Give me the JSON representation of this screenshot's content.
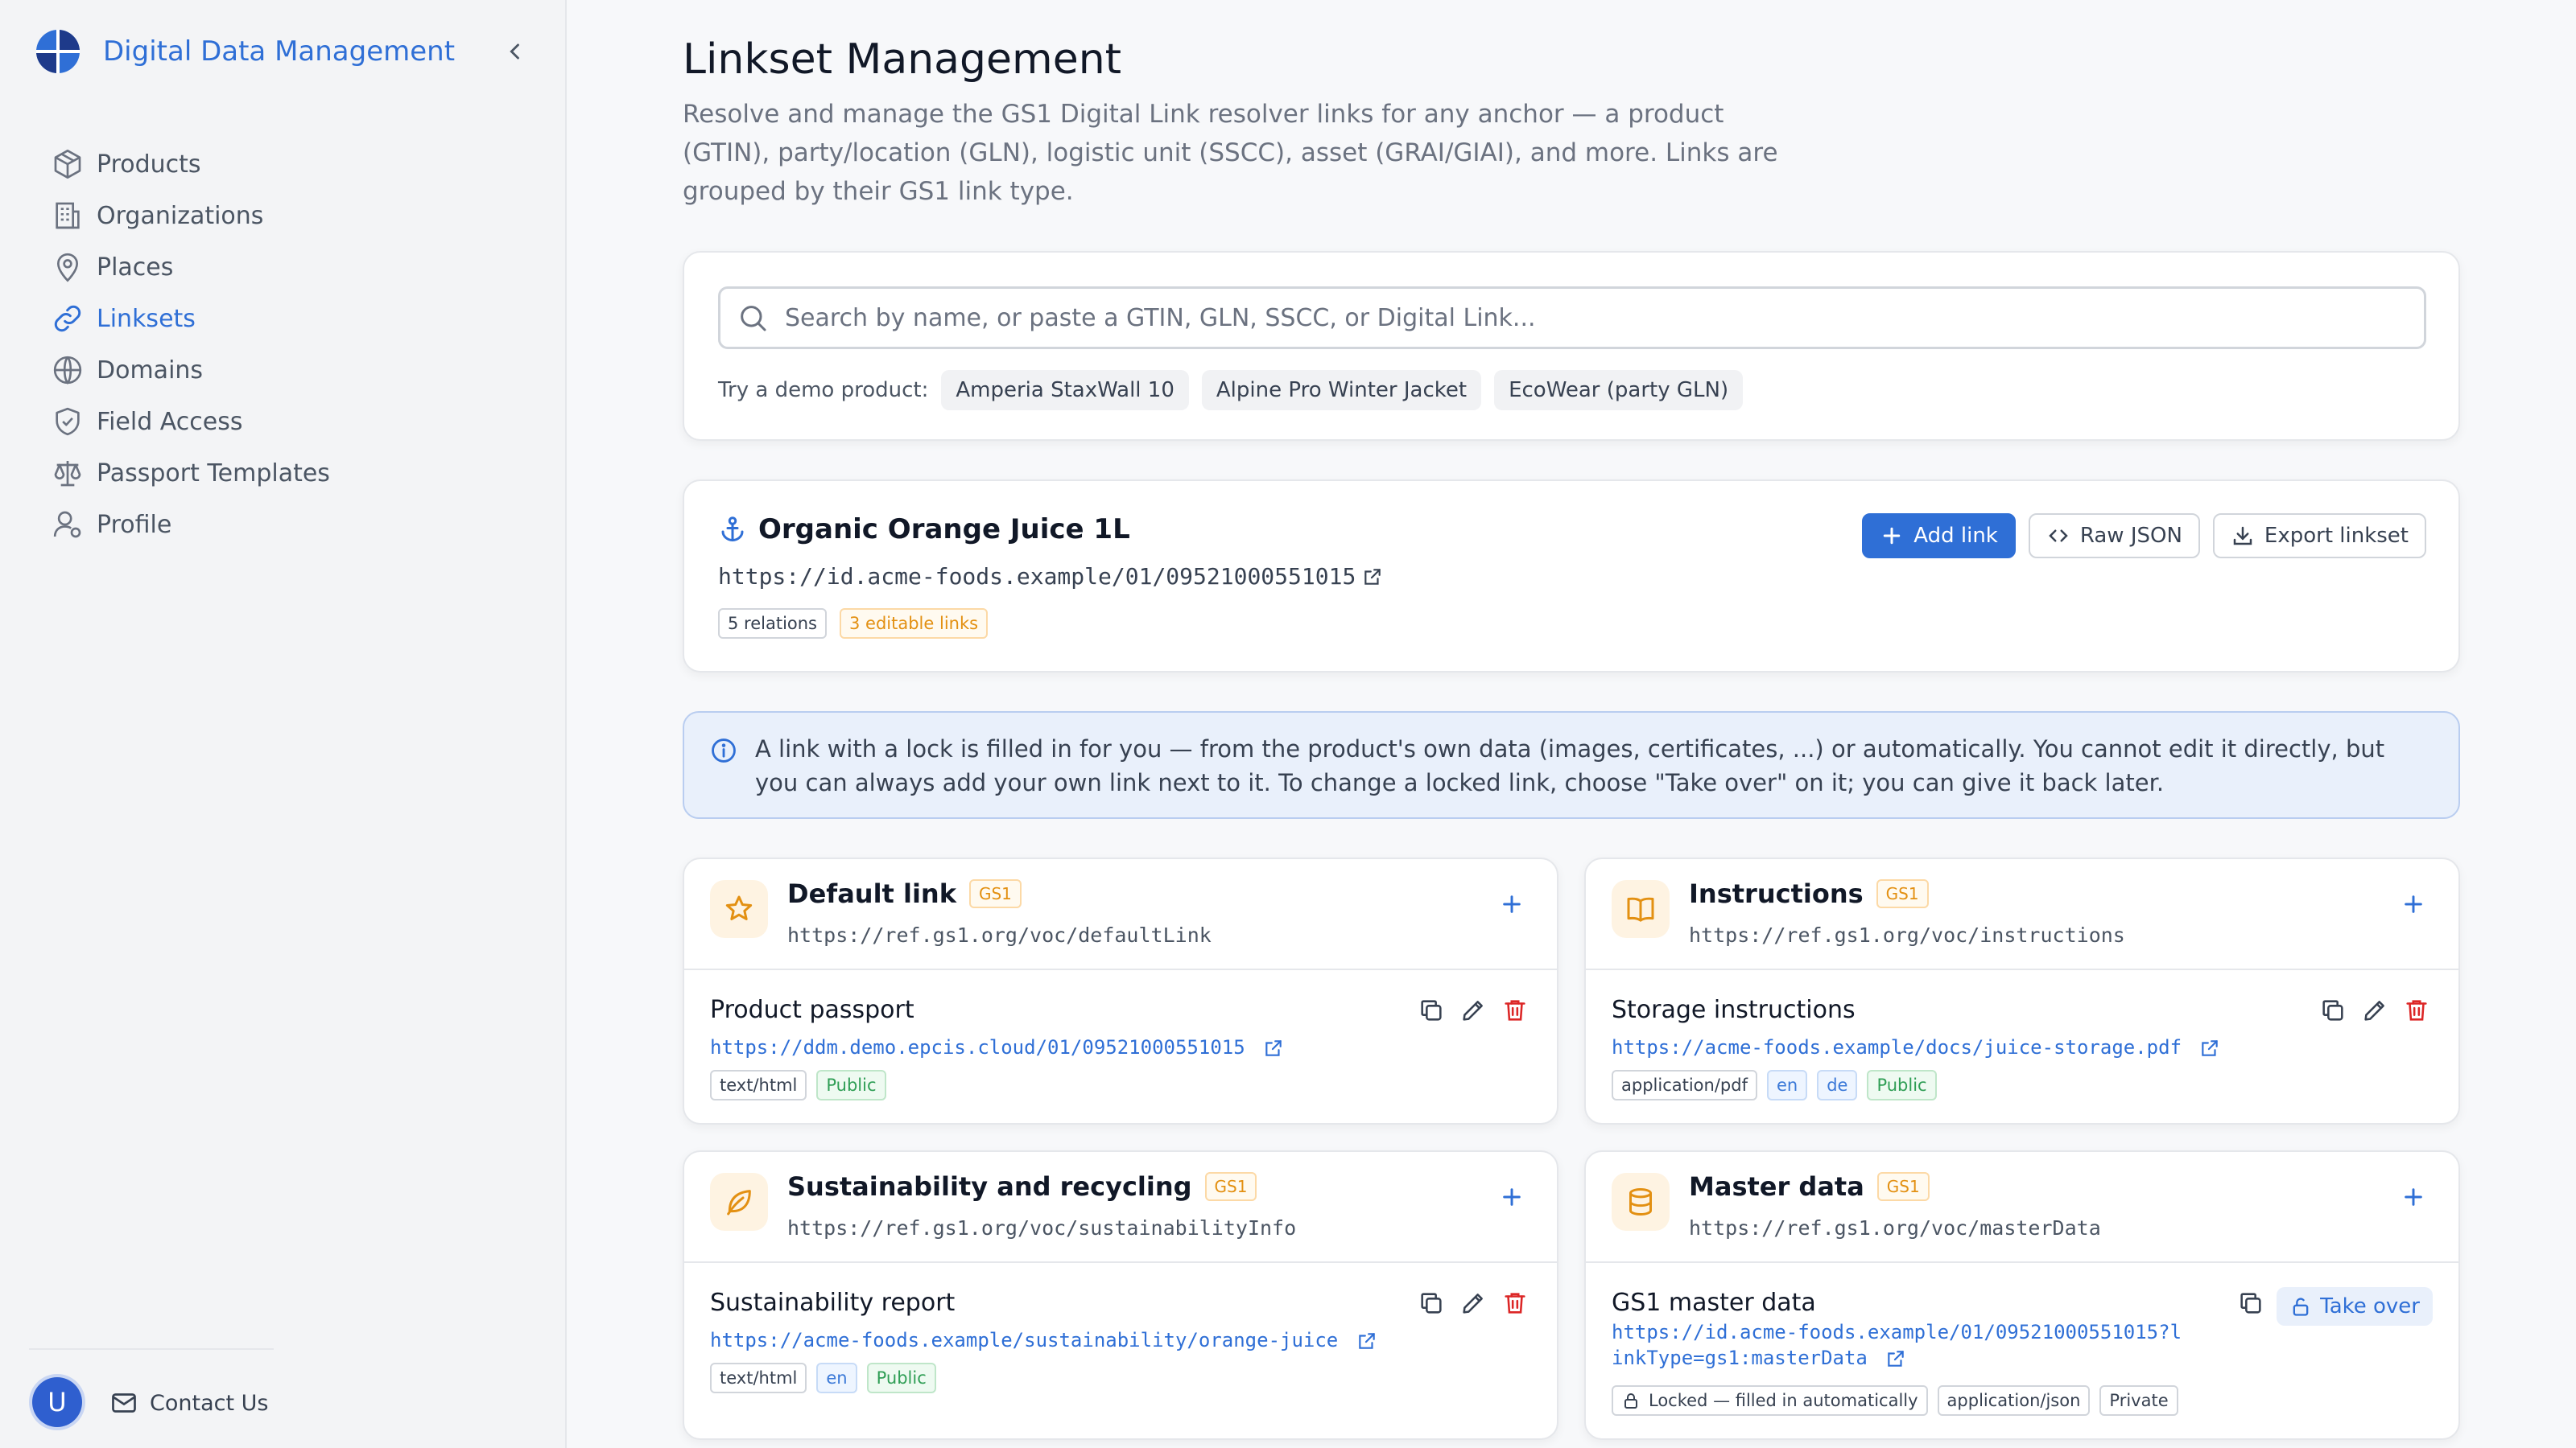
{
  "app": {
    "title": "Digital Data Management"
  },
  "sidebar": {
    "items": [
      {
        "label": "Products",
        "icon": "box-icon"
      },
      {
        "label": "Organizations",
        "icon": "building-icon"
      },
      {
        "label": "Places",
        "icon": "map-pin-icon"
      },
      {
        "label": "Linksets",
        "icon": "link-icon",
        "active": true
      },
      {
        "label": "Domains",
        "icon": "globe-icon"
      },
      {
        "label": "Field Access",
        "icon": "shield-icon"
      },
      {
        "label": "Passport Templates",
        "icon": "scale-icon"
      },
      {
        "label": "Profile",
        "icon": "user-icon"
      }
    ],
    "avatar_initial": "U",
    "contact_label": "Contact Us"
  },
  "page": {
    "title": "Linkset Management",
    "description": "Resolve and manage the GS1 Digital Link resolver links for any anchor — a product (GTIN), party/location (GLN), logistic unit (SSCC), asset (GRAI/GIAI), and more. Links are grouped by their GS1 link type."
  },
  "search": {
    "placeholder": "Search by name, or paste a GTIN, GLN, SSCC, or Digital Link...",
    "value": "",
    "demo_label": "Try a demo product:",
    "demo_chips": [
      "Amperia StaxWall 10",
      "Alpine Pro Winter Jacket",
      "EcoWear (party GLN)"
    ]
  },
  "anchor": {
    "title": "Organic Orange Juice 1L",
    "url": "https://id.acme-foods.example/01/09521000551015",
    "relations_badge": "5 relations",
    "editable_badge": "3 editable links",
    "actions": {
      "add": "Add link",
      "raw": "Raw JSON",
      "export": "Export linkset"
    }
  },
  "info": {
    "text": "A link with a lock is filled in for you — from the product's own data (images, certificates, ...) or automatically. You cannot edit it directly, but you can always add your own link next to it. To change a locked link, choose \"Take over\" on it; you can give it back later."
  },
  "link_types": [
    {
      "title": "Default link",
      "tag": "GS1",
      "uri": "https://ref.gs1.org/voc/defaultLink",
      "icon": "star-icon",
      "link": {
        "title": "Product passport",
        "url": "https://ddm.demo.epcis.cloud/01/09521000551015",
        "badges": [
          "text/html"
        ],
        "lang": [],
        "visibility": "Public"
      }
    },
    {
      "title": "Instructions",
      "tag": "GS1",
      "uri": "https://ref.gs1.org/voc/instructions",
      "icon": "book-icon",
      "link": {
        "title": "Storage instructions",
        "url": "https://acme-foods.example/docs/juice-storage.pdf",
        "badges": [
          "application/pdf"
        ],
        "lang": [
          "en",
          "de"
        ],
        "visibility": "Public"
      }
    },
    {
      "title": "Sustainability and recycling",
      "tag": "GS1",
      "uri": "https://ref.gs1.org/voc/sustainabilityInfo",
      "icon": "leaf-icon",
      "link": {
        "title": "Sustainability report",
        "url": "https://acme-foods.example/sustainability/orange-juice",
        "badges": [
          "text/html"
        ],
        "lang": [
          "en"
        ],
        "visibility": "Public"
      }
    },
    {
      "title": "Master data",
      "tag": "GS1",
      "uri": "https://ref.gs1.org/voc/masterData",
      "icon": "database-icon",
      "link": {
        "title": "GS1 master data",
        "url": "https://id.acme-foods.example/01/09521000551015?linkType=gs1:masterData",
        "lock_label": "Locked — filled in automatically",
        "badges": [
          "application/json"
        ],
        "visibility": "Private",
        "takeover_label": "Take over"
      }
    }
  ],
  "colors": {
    "accent": "#2f6fd6",
    "gs1_orange": "#e39012",
    "public_green": "#2f9e55",
    "delete_red": "#dc2626"
  }
}
